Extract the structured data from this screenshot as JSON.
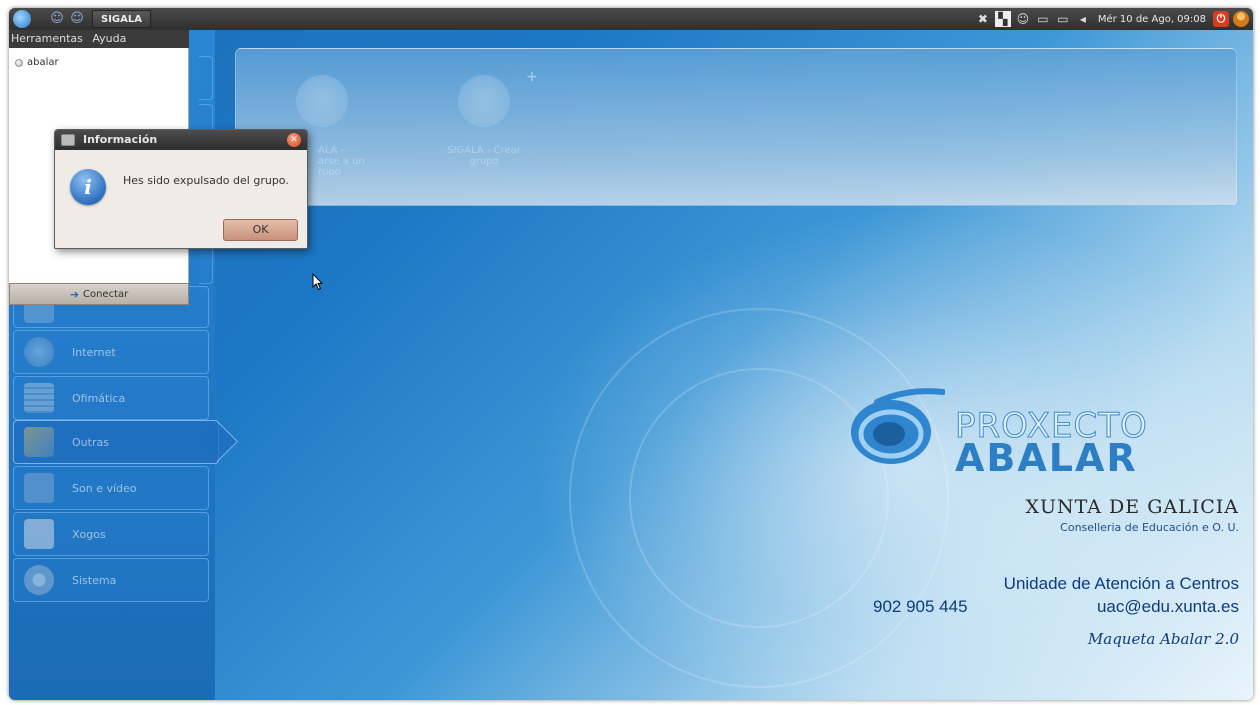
{
  "window": {
    "title": "SIGALA"
  },
  "panel": {
    "clock": "Mér 10 de Ago, 09:08"
  },
  "menu": {
    "items": [
      "Herramentas",
      "Ayuda"
    ]
  },
  "contacts": {
    "items": [
      {
        "name": "abalar"
      }
    ]
  },
  "connect": {
    "label": "Conectar"
  },
  "sidebar": {
    "categories": [
      {
        "label": "Internet"
      },
      {
        "label": "Ofimática"
      },
      {
        "label": "Outras"
      },
      {
        "label": "Son e vídeo"
      },
      {
        "label": "Xogos"
      },
      {
        "label": "Sistema"
      }
    ],
    "active": "Outras"
  },
  "launcher": {
    "apps": [
      {
        "label": "SIGALA - Unirse a un grupo",
        "visible_label": "ALA - \narse a un\nrupo"
      },
      {
        "label": "SIGALA - Crear grupo",
        "visible_label": "SIGALA - Crear\ngrupo"
      }
    ]
  },
  "dialog": {
    "title": "Información",
    "message": "Hes sido expulsado del grupo.",
    "ok_label": "OK"
  },
  "branding": {
    "proxecto": "PROXECTO",
    "abalar": "ABALAR",
    "xunta": "XUNTA DE GALICIA",
    "conselleria": "Conselleria de Educación e O. U.",
    "uac_title": "Unidade de Atención a Centros",
    "uac_phone": "902 905 445",
    "uac_email": "uac@edu.xunta.es",
    "maqueta": "Maqueta Abalar 2.0"
  },
  "colors": {
    "desktop_blue": "#1c77c4",
    "panel_dark": "#3b3b3b",
    "dialog_bg": "#efebe7",
    "ok_button": "#d9a894"
  }
}
